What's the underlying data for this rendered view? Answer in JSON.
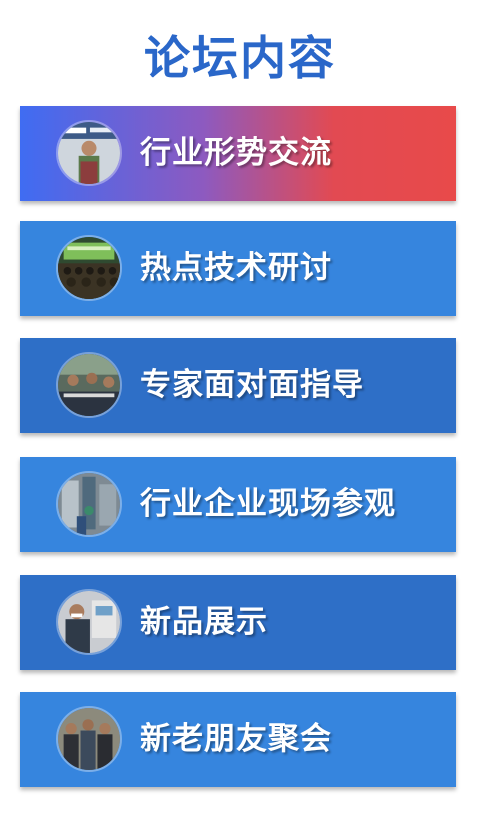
{
  "page": {
    "title": "论坛内容"
  },
  "items": [
    {
      "label": "行业形势交流",
      "photo": "speaker-at-podium-photo"
    },
    {
      "label": "热点技术研讨",
      "photo": "conference-audience-photo"
    },
    {
      "label": "专家面对面指导",
      "photo": "expert-table-photo"
    },
    {
      "label": "行业企业现场参观",
      "photo": "factory-visit-photo"
    },
    {
      "label": "新品展示",
      "photo": "product-showcase-photo"
    },
    {
      "label": "新老朋友聚会",
      "photo": "friends-gathering-photo"
    }
  ],
  "colors": {
    "title": "#2a67c9",
    "card_blue": "#3685de",
    "card_dark_blue": "#2e6fc7",
    "gradient_start": "#3f6cf2",
    "gradient_end": "#e84a4a"
  }
}
